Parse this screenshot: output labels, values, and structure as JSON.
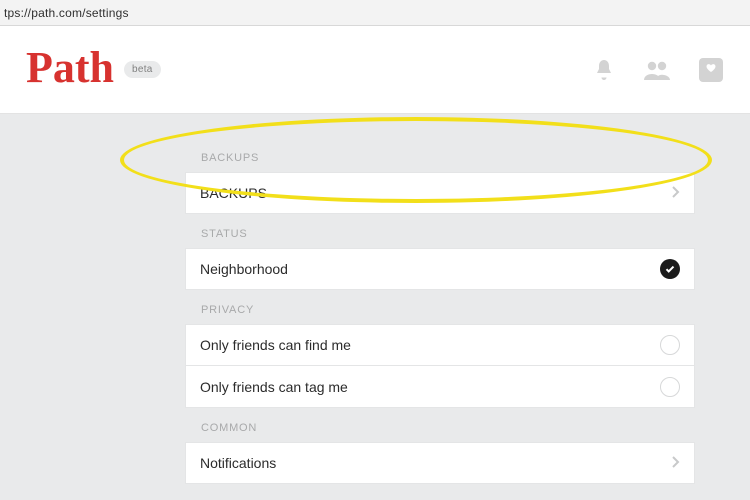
{
  "url": "tps://path.com/settings",
  "brand": {
    "name": "Path",
    "badge": "beta"
  },
  "sections": {
    "backups": {
      "header": "BACKUPS",
      "row_label": "BACKUPS"
    },
    "status": {
      "header": "STATUS",
      "row_label": "Neighborhood",
      "checked": true
    },
    "privacy": {
      "header": "PRIVACY",
      "find_me": "Only friends can find me",
      "tag_me": "Only friends can tag me"
    },
    "common": {
      "header": "COMMON",
      "notifications": "Notifications"
    }
  }
}
